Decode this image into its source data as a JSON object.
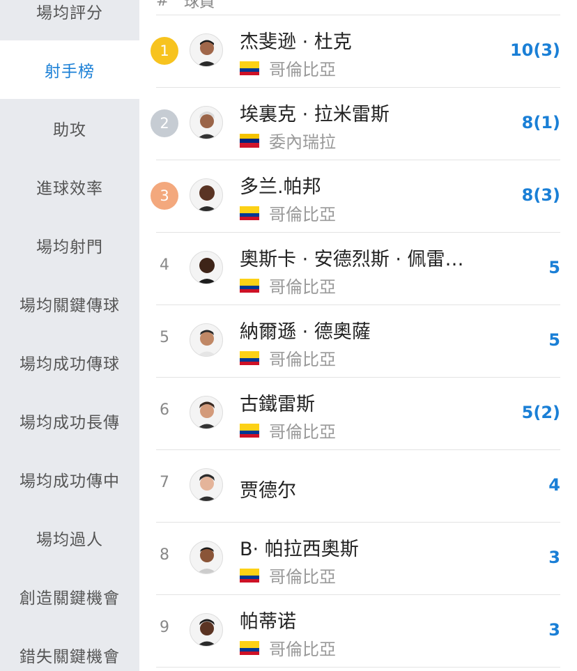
{
  "sidebar": {
    "items": [
      {
        "label": "場均評分"
      },
      {
        "label": "射手榜",
        "active": true
      },
      {
        "label": "助攻"
      },
      {
        "label": "進球效率"
      },
      {
        "label": "場均射門"
      },
      {
        "label": "場均關鍵傳球"
      },
      {
        "label": "場均成功傳球"
      },
      {
        "label": "場均成功長傳"
      },
      {
        "label": "場均成功傳中"
      },
      {
        "label": "場均過人"
      },
      {
        "label": "創造關鍵機會"
      },
      {
        "label": "錯失關鍵機會"
      }
    ]
  },
  "header": {
    "rank": "#",
    "player": "球員"
  },
  "colors": {
    "accent": "#1a7fd6",
    "gold": "#f7c31f",
    "silver": "#c6ccd3",
    "bronze": "#f3a87d"
  },
  "players": [
    {
      "rank": "1",
      "name": "杰斐逊 · 杜克",
      "team": "哥倫比亞",
      "flag": "colombia",
      "stat": "10(3)"
    },
    {
      "rank": "2",
      "name": "埃裏克 · 拉米雷斯",
      "team": "委內瑞拉",
      "flag": "venezuela",
      "stat": "8(1)"
    },
    {
      "rank": "3",
      "name": "多兰.帕邦",
      "team": "哥倫比亞",
      "flag": "colombia",
      "stat": "8(3)"
    },
    {
      "rank": "4",
      "name": "奧斯卡 · 安德烈斯 · 佩雷…",
      "team": "哥倫比亞",
      "flag": "colombia",
      "stat": "5"
    },
    {
      "rank": "5",
      "name": "納爾遜 · 德奧薩",
      "team": "哥倫比亞",
      "flag": "colombia",
      "stat": "5"
    },
    {
      "rank": "6",
      "name": "古鐵雷斯",
      "team": "哥倫比亞",
      "flag": "colombia",
      "stat": "5(2)"
    },
    {
      "rank": "7",
      "name": "贾德尔",
      "team": "",
      "flag": "",
      "stat": "4"
    },
    {
      "rank": "8",
      "name": "B· 帕拉西奧斯",
      "team": "哥倫比亞",
      "flag": "colombia",
      "stat": "3"
    },
    {
      "rank": "9",
      "name": "帕蒂诺",
      "team": "哥倫比亞",
      "flag": "colombia",
      "stat": "3"
    }
  ]
}
